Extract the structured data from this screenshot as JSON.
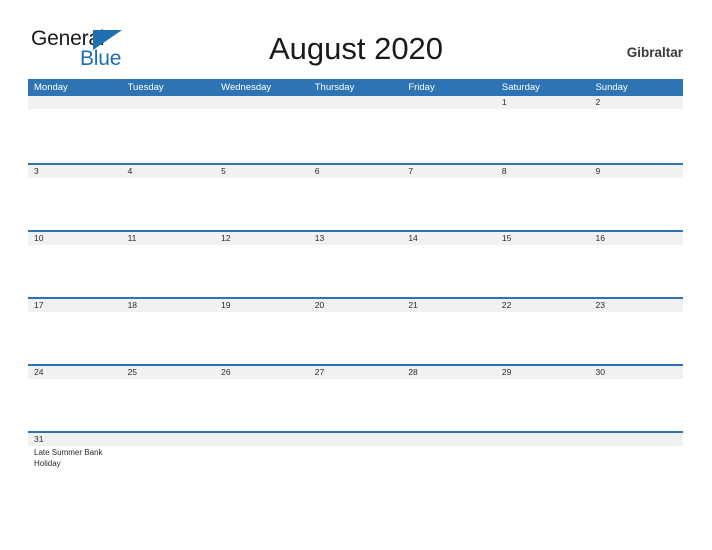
{
  "branding": {
    "logo_primary": "General",
    "logo_secondary": "Blue",
    "logo_triangle_icon": "triangle-icon",
    "primary_color": "#2e74b5",
    "logo_blue": "#1f6fb2",
    "band_gray": "#f1f1f1"
  },
  "header": {
    "title": "August 2020",
    "locale": "Gibraltar"
  },
  "calendar": {
    "weekday_headers": [
      "Monday",
      "Tuesday",
      "Wednesday",
      "Thursday",
      "Friday",
      "Saturday",
      "Sunday"
    ],
    "weeks": [
      [
        {
          "date": ""
        },
        {
          "date": ""
        },
        {
          "date": ""
        },
        {
          "date": ""
        },
        {
          "date": ""
        },
        {
          "date": "1"
        },
        {
          "date": "2"
        }
      ],
      [
        {
          "date": "3"
        },
        {
          "date": "4"
        },
        {
          "date": "5"
        },
        {
          "date": "6"
        },
        {
          "date": "7"
        },
        {
          "date": "8"
        },
        {
          "date": "9"
        }
      ],
      [
        {
          "date": "10"
        },
        {
          "date": "11"
        },
        {
          "date": "12"
        },
        {
          "date": "13"
        },
        {
          "date": "14"
        },
        {
          "date": "15"
        },
        {
          "date": "16"
        }
      ],
      [
        {
          "date": "17"
        },
        {
          "date": "18"
        },
        {
          "date": "19"
        },
        {
          "date": "20"
        },
        {
          "date": "21"
        },
        {
          "date": "22"
        },
        {
          "date": "23"
        }
      ],
      [
        {
          "date": "24"
        },
        {
          "date": "25"
        },
        {
          "date": "26"
        },
        {
          "date": "27"
        },
        {
          "date": "28"
        },
        {
          "date": "29"
        },
        {
          "date": "30"
        }
      ],
      [
        {
          "date": "31",
          "event": "Late Summer Bank Holiday"
        },
        {
          "date": ""
        },
        {
          "date": ""
        },
        {
          "date": ""
        },
        {
          "date": ""
        },
        {
          "date": ""
        },
        {
          "date": ""
        }
      ]
    ]
  }
}
